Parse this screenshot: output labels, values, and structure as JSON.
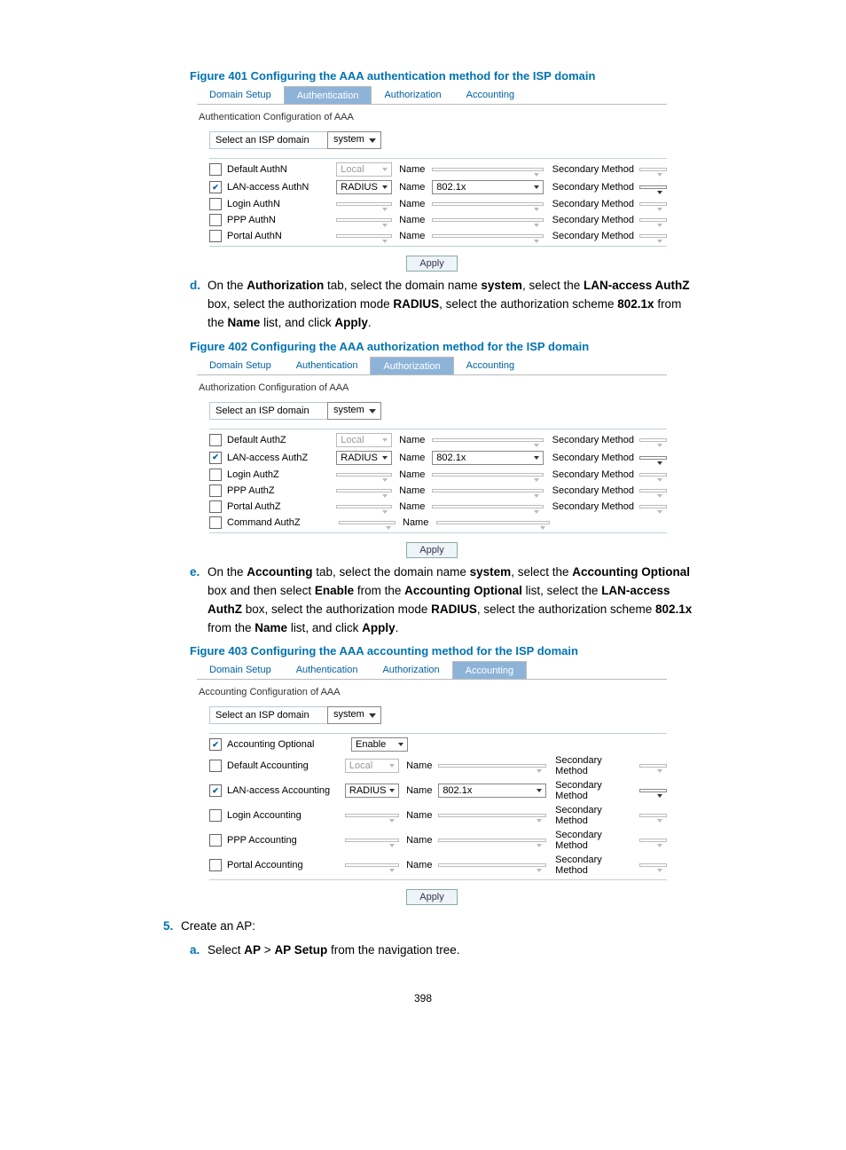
{
  "fig401": {
    "caption": "Figure 401 Configuring the AAA authentication method for the ISP domain",
    "tabs": [
      "Domain Setup",
      "Authentication",
      "Authorization",
      "Accounting"
    ],
    "active_tab": 1,
    "conf_title": "Authentication Configuration of AAA",
    "domain_label": "Select an ISP domain",
    "domain_value": "system",
    "name_col": "Name",
    "sm_col": "Secondary Method",
    "apply": "Apply",
    "rows": [
      {
        "checked": false,
        "label": "Default AuthN",
        "method": "Local",
        "method_disabled": true,
        "name": "",
        "name_disabled": true,
        "sm_disabled": true
      },
      {
        "checked": true,
        "label": "LAN-access AuthN",
        "method": "RADIUS",
        "method_disabled": false,
        "name": "802.1x",
        "name_disabled": false,
        "sm_disabled": false
      },
      {
        "checked": false,
        "label": "Login AuthN",
        "method": "",
        "method_disabled": true,
        "name": "",
        "name_disabled": true,
        "sm_disabled": true
      },
      {
        "checked": false,
        "label": "PPP AuthN",
        "method": "",
        "method_disabled": true,
        "name": "",
        "name_disabled": true,
        "sm_disabled": true
      },
      {
        "checked": false,
        "label": "Portal AuthN",
        "method": "",
        "method_disabled": true,
        "name": "",
        "name_disabled": true,
        "sm_disabled": true
      }
    ]
  },
  "step_d": {
    "letter": "d.",
    "text_parts": [
      "On the ",
      "Authorization",
      " tab, select the domain name ",
      "system",
      ", select the ",
      "LAN-access AuthZ",
      " box, select the authorization mode ",
      "RADIUS",
      ", select the authorization scheme ",
      "802.1x",
      " from the ",
      "Name",
      " list, and click ",
      "Apply",
      "."
    ]
  },
  "fig402": {
    "caption": "Figure 402 Configuring the AAA authorization method for the ISP domain",
    "tabs": [
      "Domain Setup",
      "Authentication",
      "Authorization",
      "Accounting"
    ],
    "active_tab": 2,
    "conf_title": "Authorization Configuration of AAA",
    "domain_label": "Select an ISP domain",
    "domain_value": "system",
    "name_col": "Name",
    "sm_col": "Secondary Method",
    "apply": "Apply",
    "rows": [
      {
        "checked": false,
        "label": "Default AuthZ",
        "method": "Local",
        "method_disabled": true,
        "name": "",
        "name_disabled": true,
        "sm_disabled": true
      },
      {
        "checked": true,
        "label": "LAN-access AuthZ",
        "method": "RADIUS",
        "method_disabled": false,
        "name": "802.1x",
        "name_disabled": false,
        "sm_disabled": false
      },
      {
        "checked": false,
        "label": "Login AuthZ",
        "method": "",
        "method_disabled": true,
        "name": "",
        "name_disabled": true,
        "sm_disabled": true
      },
      {
        "checked": false,
        "label": "PPP AuthZ",
        "method": "",
        "method_disabled": true,
        "name": "",
        "name_disabled": true,
        "sm_disabled": true
      },
      {
        "checked": false,
        "label": "Portal AuthZ",
        "method": "",
        "method_disabled": true,
        "name": "",
        "name_disabled": true,
        "sm_disabled": true
      },
      {
        "checked": false,
        "label": "Command AuthZ",
        "method": "",
        "method_disabled": true,
        "name": "",
        "name_disabled": true,
        "sm_disabled": true,
        "no_sm": true
      }
    ]
  },
  "step_e": {
    "letter": "e.",
    "text_parts": [
      "On the ",
      "Accounting",
      " tab, select the domain name ",
      "system",
      ", select the ",
      "Accounting Optional",
      " box and then select ",
      "Enable",
      " from the ",
      "Accounting Optional",
      " list, select the ",
      "LAN-access AuthZ",
      " box, select the authorization mode ",
      "RADIUS",
      ", select the authorization scheme ",
      "802.1x",
      " from the ",
      "Name",
      " list, and click ",
      "Apply",
      "."
    ]
  },
  "fig403": {
    "caption": "Figure 403 Configuring the AAA accounting method for the ISP domain",
    "tabs": [
      "Domain Setup",
      "Authentication",
      "Authorization",
      "Accounting"
    ],
    "active_tab": 3,
    "conf_title": "Accounting Configuration of AAA",
    "domain_label": "Select an ISP domain",
    "domain_value": "system",
    "name_col": "Name",
    "sm_col": "Secondary Method",
    "apply": "Apply",
    "opt_row": {
      "checked": true,
      "label": "Accounting Optional",
      "method": "Enable"
    },
    "rows": [
      {
        "checked": false,
        "label": "Default Accounting",
        "method": "Local",
        "method_disabled": true,
        "name": "",
        "name_disabled": true,
        "sm_disabled": true
      },
      {
        "checked": true,
        "label": "LAN-access Accounting",
        "method": "RADIUS",
        "method_disabled": false,
        "name": "802.1x",
        "name_disabled": false,
        "sm_disabled": false
      },
      {
        "checked": false,
        "label": "Login Accounting",
        "method": "",
        "method_disabled": true,
        "name": "",
        "name_disabled": true,
        "sm_disabled": true
      },
      {
        "checked": false,
        "label": "PPP Accounting",
        "method": "",
        "method_disabled": true,
        "name": "",
        "name_disabled": true,
        "sm_disabled": true
      },
      {
        "checked": false,
        "label": "Portal Accounting",
        "method": "",
        "method_disabled": true,
        "name": "",
        "name_disabled": true,
        "sm_disabled": true
      }
    ]
  },
  "step5": {
    "num": "5.",
    "text": "Create an AP:"
  },
  "step5a": {
    "letter": "a.",
    "parts": [
      "Select ",
      "AP",
      " > ",
      "AP Setup",
      " from the navigation tree."
    ]
  },
  "page_number": "398"
}
